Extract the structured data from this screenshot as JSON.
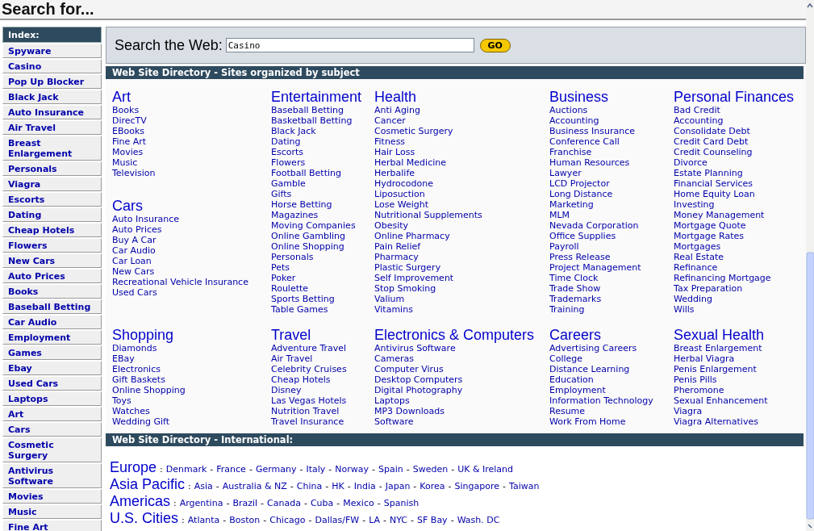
{
  "header": {
    "title": "Search for..."
  },
  "sidebar": {
    "title": "Index:",
    "items": [
      "Spyware",
      "Casino",
      "Pop Up Blocker",
      "Black Jack",
      "Auto Insurance",
      "Air Travel",
      "Breast Enlargement",
      "Personals",
      "Viagra",
      "Escorts",
      "Dating",
      "Cheap Hotels",
      "Flowers",
      "New Cars",
      "Auto Prices",
      "Books",
      "Baseball Betting",
      "Car Audio",
      "Employment",
      "Games",
      "Ebay",
      "Used Cars",
      "Laptops",
      "Art",
      "Cars",
      "Cosmetic Surgery",
      "Antivirus Software",
      "Movies",
      "Music",
      "Fine Art"
    ]
  },
  "search": {
    "label": "Search the Web:",
    "value": "Casino",
    "button": "GO"
  },
  "directory": {
    "title": "Web Site Directory - Sites organized by subject",
    "rows": [
      {
        "cells": [
          {
            "categories": [
              {
                "title": "Art",
                "links": [
                  "Books",
                  "DirecTV",
                  "EBooks",
                  "Fine Art",
                  "Movies",
                  "Music",
                  "Television"
                ]
              },
              {
                "title": "Cars",
                "links": [
                  "Auto Insurance",
                  "Auto Prices",
                  "Buy A Car",
                  "Car Audio",
                  "Car Loan",
                  "New Cars",
                  "Recreational Vehicle Insurance",
                  "Used Cars"
                ]
              }
            ]
          },
          {
            "categories": [
              {
                "title": "Entertainment",
                "links": [
                  "Baseball Betting",
                  "Basketball Betting",
                  "Black Jack",
                  "Dating",
                  "Escorts",
                  "Flowers",
                  "Football Betting",
                  "Gamble",
                  "Gifts",
                  "Horse Betting",
                  "Magazines",
                  "Moving Companies",
                  "Online Gambling",
                  "Online Shopping",
                  "Personals",
                  "Pets",
                  "Poker",
                  "Roulette",
                  "Sports Betting",
                  "Table Games"
                ]
              }
            ]
          },
          {
            "categories": [
              {
                "title": "Health",
                "links": [
                  "Anti Aging",
                  "Cancer",
                  "Cosmetic Surgery",
                  "Fitness",
                  "Hair Loss",
                  "Herbal Medicine",
                  "Herbalife",
                  "Hydrocodone",
                  "Liposuction",
                  "Lose Weight",
                  "Nutritional Supplements",
                  "Obesity",
                  "Online Pharmacy",
                  "Pain Relief",
                  "Pharmacy",
                  "Plastic Surgery",
                  "Self Improvement",
                  "Stop Smoking",
                  "Valium",
                  "Vitamins"
                ]
              }
            ]
          },
          {
            "categories": [
              {
                "title": "Business",
                "links": [
                  "Auctions",
                  "Accounting",
                  "Business Insurance",
                  "Conference Call",
                  "Franchise",
                  "Human Resources",
                  "Lawyer",
                  "LCD Projector",
                  "Long Distance",
                  "Marketing",
                  "MLM",
                  "Nevada Corporation",
                  "Office Supplies",
                  "Payroll",
                  "Press Release",
                  "Project Management",
                  "Time Clock",
                  "Trade Show",
                  "Trademarks",
                  "Training"
                ]
              }
            ]
          },
          {
            "categories": [
              {
                "title": "Personal Finances",
                "links": [
                  "Bad Credit",
                  "Accounting",
                  "Consolidate Debt",
                  "Credit Card Debt",
                  "Credit Counseling",
                  "Divorce",
                  "Estate Planning",
                  "Financial Services",
                  "Home Equity Loan",
                  "Investing",
                  "Money Management",
                  "Mortgage Quote",
                  "Mortgage Rates",
                  "Mortgages",
                  "Real Estate",
                  "Refinance",
                  "Refinancing Mortgage",
                  "Tax Preparation",
                  "Wedding",
                  "Wills"
                ]
              }
            ]
          }
        ]
      },
      {
        "cells": [
          {
            "categories": [
              {
                "title": "Shopping",
                "links": [
                  "Diamonds",
                  "EBay",
                  "Electronics",
                  "Gift Baskets",
                  "Online Shopping",
                  "Toys",
                  "Watches",
                  "Wedding Gift"
                ]
              }
            ]
          },
          {
            "categories": [
              {
                "title": "Travel",
                "links": [
                  "Adventure Travel",
                  "Air Travel",
                  "Celebrity Cruises",
                  "Cheap Hotels",
                  "Disney",
                  "Las Vegas Hotels",
                  "Nutrition Travel",
                  "Travel Insurance"
                ]
              }
            ]
          },
          {
            "categories": [
              {
                "title": "Electronics & Computers",
                "links": [
                  "Antivirus Software",
                  "Cameras",
                  "Computer Virus",
                  "Desktop Computers",
                  "Digital Photography",
                  "Laptops",
                  "MP3 Downloads",
                  "Software"
                ]
              }
            ]
          },
          {
            "categories": [
              {
                "title": "Careers",
                "links": [
                  "Advertising Careers",
                  "College",
                  "Distance Learning",
                  "Education",
                  "Employment",
                  "Information Technology",
                  "Resume",
                  "Work From Home"
                ]
              }
            ]
          },
          {
            "categories": [
              {
                "title": "Sexual Health",
                "links": [
                  "Breast Enlargement",
                  "Herbal Viagra",
                  "Penis Enlargement",
                  "Penis Pills",
                  "Pheromone",
                  "Sexual Enhancement",
                  "Viagra",
                  "Viagra Alternatives"
                ]
              }
            ]
          }
        ]
      }
    ]
  },
  "international": {
    "title": "Web Site Directory - International:",
    "name_delimiter": ":",
    "link_separator": "-",
    "regions": [
      {
        "name": "Europe",
        "links": [
          "Denmark",
          "France",
          "Germany",
          "Italy",
          "Norway",
          "Spain",
          "Sweden",
          "UK & Ireland"
        ]
      },
      {
        "name": "Asia Pacific",
        "links": [
          "Asia",
          "Australia & NZ",
          "China",
          "HK",
          "India",
          "Japan",
          "Korea",
          "Singapore",
          "Taiwan"
        ]
      },
      {
        "name": "Americas",
        "links": [
          "Argentina",
          "Brazil",
          "Canada",
          "Cuba",
          "Mexico",
          "Spanish"
        ]
      },
      {
        "name": "U.S. Cities",
        "links": [
          "Atlanta",
          "Boston",
          "Chicago",
          "Dallas/FW",
          "LA",
          "NYC",
          "SF Bay",
          "Wash. DC"
        ]
      }
    ]
  }
}
